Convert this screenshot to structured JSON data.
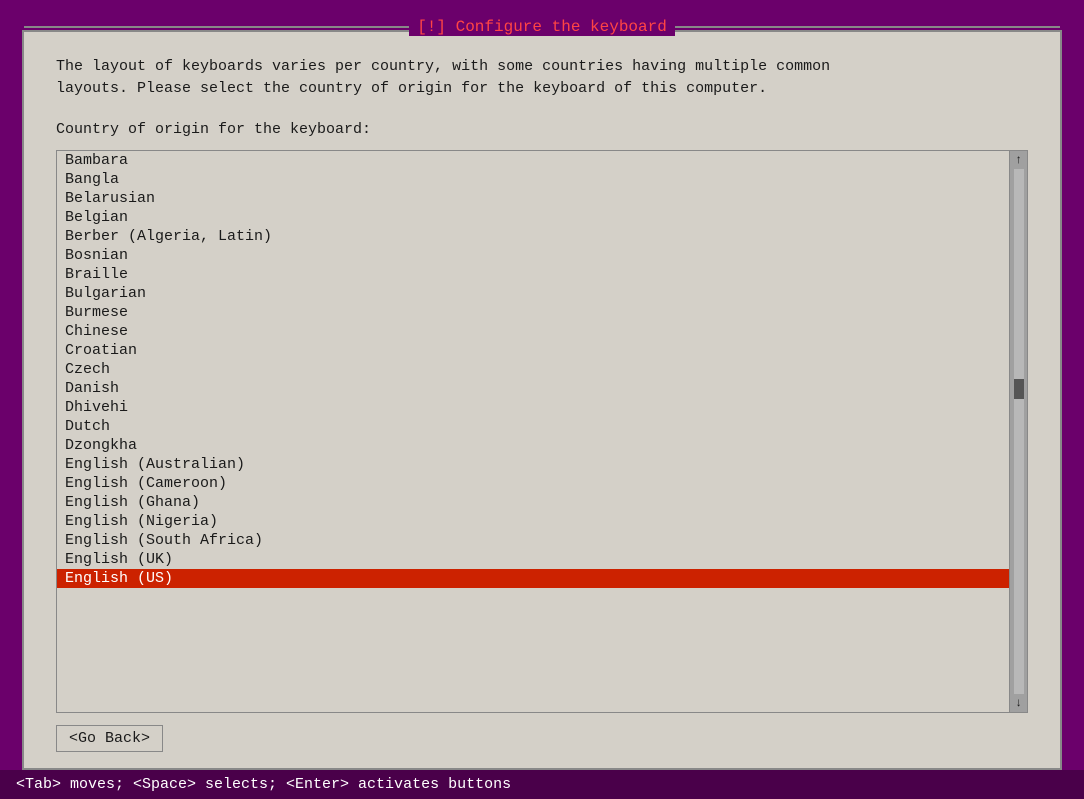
{
  "window": {
    "title": "[!] Configure the keyboard",
    "background": "#6b006b"
  },
  "description": {
    "line1": "The layout of keyboards varies per country, with some countries having multiple common",
    "line2": "layouts. Please select the country of origin for the keyboard of this computer.",
    "prompt": "Country of origin for the keyboard:"
  },
  "list": {
    "items": [
      {
        "label": "Bambara",
        "selected": false
      },
      {
        "label": "Bangla",
        "selected": false
      },
      {
        "label": "Belarusian",
        "selected": false
      },
      {
        "label": "Belgian",
        "selected": false
      },
      {
        "label": "Berber (Algeria, Latin)",
        "selected": false
      },
      {
        "label": "Bosnian",
        "selected": false
      },
      {
        "label": "Braille",
        "selected": false
      },
      {
        "label": "Bulgarian",
        "selected": false
      },
      {
        "label": "Burmese",
        "selected": false
      },
      {
        "label": "Chinese",
        "selected": false
      },
      {
        "label": "Croatian",
        "selected": false
      },
      {
        "label": "Czech",
        "selected": false
      },
      {
        "label": "Danish",
        "selected": false
      },
      {
        "label": "Dhivehi",
        "selected": false
      },
      {
        "label": "Dutch",
        "selected": false
      },
      {
        "label": "Dzongkha",
        "selected": false
      },
      {
        "label": "English (Australian)",
        "selected": false
      },
      {
        "label": "English (Cameroon)",
        "selected": false
      },
      {
        "label": "English (Ghana)",
        "selected": false
      },
      {
        "label": "English (Nigeria)",
        "selected": false
      },
      {
        "label": "English (South Africa)",
        "selected": false
      },
      {
        "label": "English (UK)",
        "selected": false
      },
      {
        "label": "English (US)",
        "selected": true
      }
    ]
  },
  "buttons": [
    {
      "label": "<Go Back>",
      "name": "go-back-button"
    }
  ],
  "status_bar": {
    "text": "<Tab> moves; <Space> selects; <Enter> activates buttons"
  }
}
